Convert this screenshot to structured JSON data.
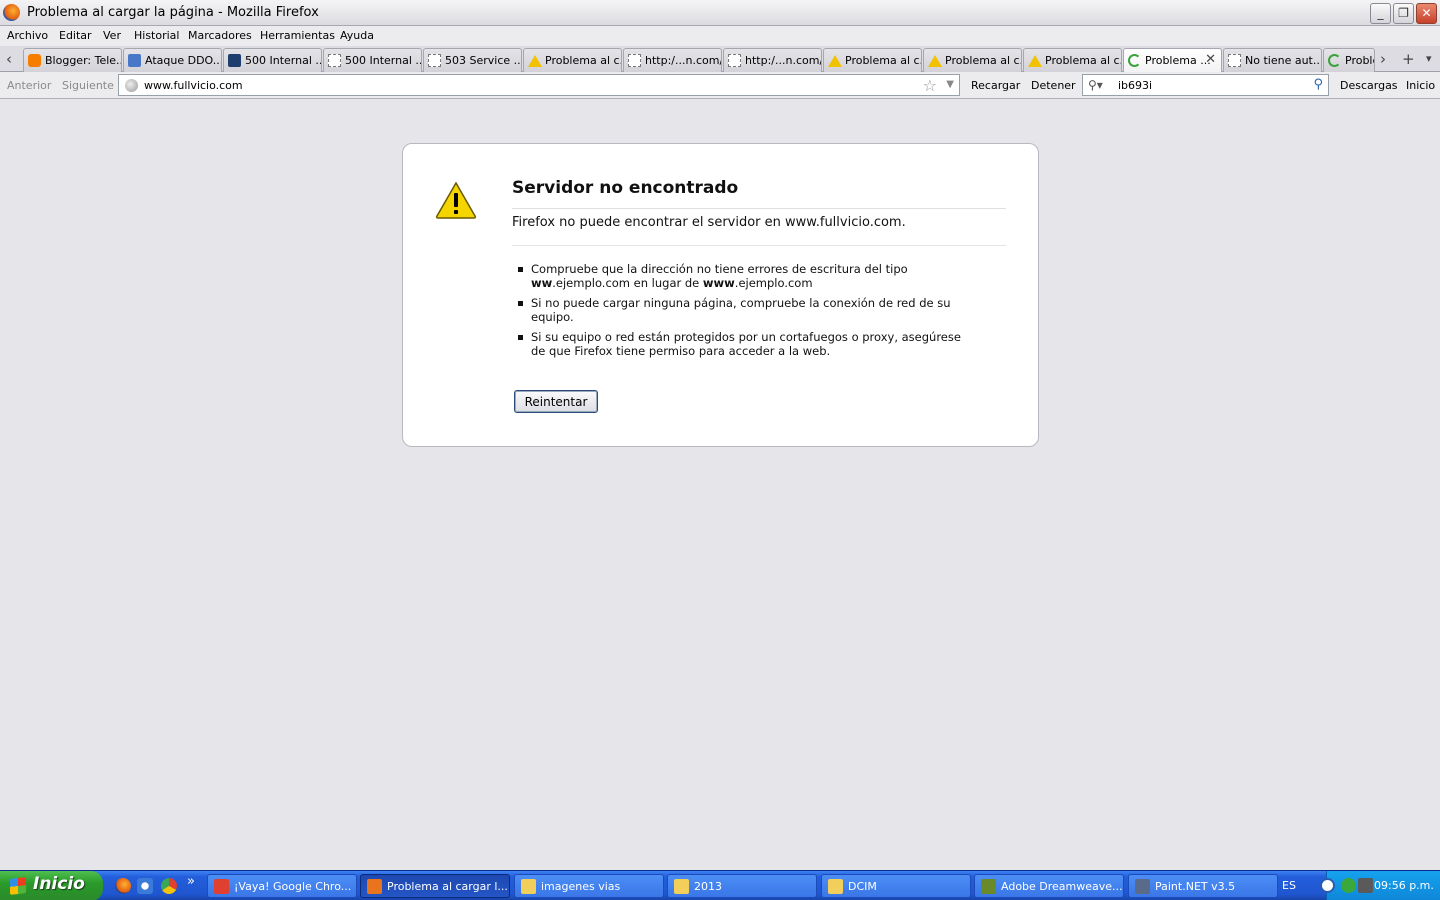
{
  "window": {
    "title": "Problema al cargar la página - Mozilla Firefox",
    "minimize_label": "_",
    "maximize_label": "❐",
    "close_label": "✕"
  },
  "menu": [
    "Archivo",
    "Editar",
    "Ver",
    "Historial",
    "Marcadores",
    "Herramientas",
    "Ayuda"
  ],
  "tabs": [
    {
      "label": "Blogger: Tele...",
      "icon": "blogger"
    },
    {
      "label": "Ataque DDO...",
      "icon": "ddo"
    },
    {
      "label": "500 Internal ...",
      "icon": "v"
    },
    {
      "label": "500 Internal ...",
      "icon": "blank"
    },
    {
      "label": "503 Service ...",
      "icon": "blank"
    },
    {
      "label": "Problema al c...",
      "icon": "warn"
    },
    {
      "label": "http:/...n.com/",
      "icon": "blank"
    },
    {
      "label": "http:/...n.com/",
      "icon": "blank"
    },
    {
      "label": "Problema al c...",
      "icon": "warn"
    },
    {
      "label": "Problema al c...",
      "icon": "warn"
    },
    {
      "label": "Problema al c...",
      "icon": "warn"
    },
    {
      "label": "Problema ...",
      "icon": "spin",
      "active": true,
      "close": "✕"
    },
    {
      "label": "No tiene aut...",
      "icon": "blank"
    },
    {
      "label": "Proble",
      "icon": "spin"
    }
  ],
  "tabstrip": {
    "scroll_left": "‹",
    "scroll_right": "›",
    "new_tab": "+",
    "list_tabs": "▾"
  },
  "nav": {
    "back": "Anterior",
    "forward": "Siguiente",
    "url": "www.fullvicio.com",
    "reload": "Recargar",
    "stop": "Detener",
    "search_value": "ib693i",
    "downloads": "Descargas",
    "home": "Inicio",
    "star": "☆",
    "dropdown": "▼"
  },
  "error": {
    "title": "Servidor no encontrado",
    "description": "Firefox no puede encontrar el servidor en www.fullvicio.com.",
    "suggestion_1a": "Compruebe que la dirección no tiene errores de escritura del tipo",
    "suggestion_1b_bold1": "ww",
    "suggestion_1b_mid": ".ejemplo.com en lugar de ",
    "suggestion_1b_bold2": "www",
    "suggestion_1b_end": ".ejemplo.com",
    "suggestion_2": "Si no puede cargar ninguna página, compruebe la conexión de red de su equipo.",
    "suggestion_3": "Si su equipo o red están protegidos por un cortafuegos o proxy, asegúrese de que Firefox tiene permiso para acceder a la web.",
    "retry_label": "Reintentar"
  },
  "taskbar": {
    "start_label": "Inicio",
    "quicklaunch_more": "»",
    "tasks": [
      {
        "label": "¡Vaya! Google Chro...",
        "icon_color": "#e04030"
      },
      {
        "label": "Problema al cargar l...",
        "icon_color": "#e8741e",
        "active": true
      },
      {
        "label": "imagenes vias",
        "icon_color": "#f2cf5a"
      },
      {
        "label": "2013",
        "icon_color": "#f2cf5a"
      },
      {
        "label": "DCIM",
        "icon_color": "#f2cf5a"
      },
      {
        "label": "Adobe Dreamweave...",
        "icon_color": "#6a8a2a"
      },
      {
        "label": "Paint.NET v3.5",
        "icon_color": "#5a6a8a"
      }
    ],
    "language": "ES",
    "clock": "09:56 p.m."
  }
}
